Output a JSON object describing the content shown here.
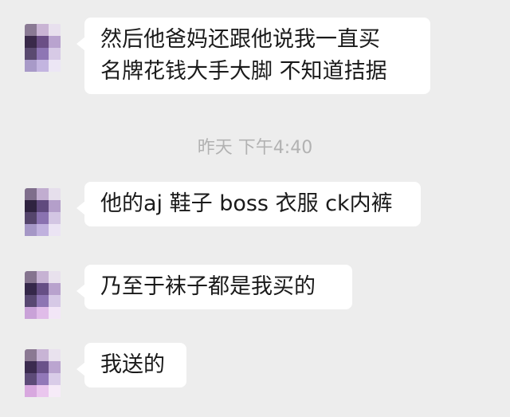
{
  "chat": {
    "messages": [
      {
        "lines": [
          "然后他爸妈还跟他说我一直买",
          "名牌花钱大手大脚 不知道拮据"
        ]
      },
      {
        "lines": [
          "他的aj 鞋子 boss 衣服 ck内裤"
        ]
      },
      {
        "lines": [
          "乃至于袜子都是我买的"
        ]
      },
      {
        "lines": [
          "我送的"
        ]
      }
    ],
    "timestamp": "昨天 下午4:40"
  }
}
